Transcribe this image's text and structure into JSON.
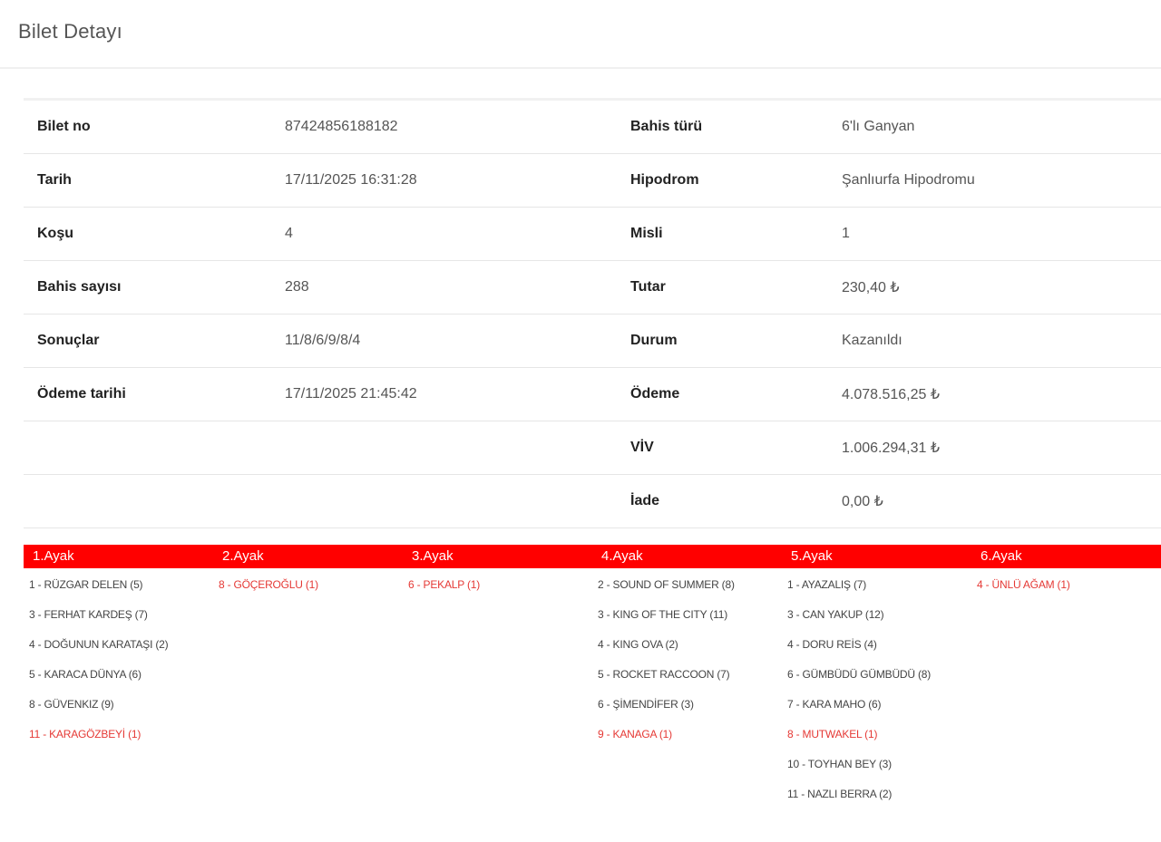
{
  "page": {
    "title": "Bilet Detayı"
  },
  "details": {
    "rows": [
      {
        "label1": "Bilet no",
        "value1": "87424856188182",
        "label2": "Bahis türü",
        "value2": "6'lı Ganyan"
      },
      {
        "label1": "Tarih",
        "value1": "17/11/2025 16:31:28",
        "label2": "Hipodrom",
        "value2": "Şanlıurfa Hipodromu"
      },
      {
        "label1": "Koşu",
        "value1": "4",
        "label2": "Misli",
        "value2": "1"
      },
      {
        "label1": "Bahis sayısı",
        "value1": "288",
        "label2": "Tutar",
        "value2": "230,40 ₺"
      },
      {
        "label1": "Sonuçlar",
        "value1": "11/8/6/9/8/4",
        "label2": "Durum",
        "value2": "Kazanıldı"
      },
      {
        "label1": "Ödeme tarihi",
        "value1": "17/11/2025 21:45:42",
        "label2": "Ödeme",
        "value2": "4.078.516,25 ₺"
      },
      {
        "label1": "",
        "value1": "",
        "label2": "VİV",
        "value2": "1.006.294,31 ₺"
      },
      {
        "label1": "",
        "value1": "",
        "label2": "İade",
        "value2": "0,00 ₺"
      }
    ]
  },
  "legs": {
    "header_color": "#ff0000",
    "winner_color": "#e53935",
    "items": [
      {
        "title": "1.Ayak",
        "entries": [
          {
            "text": "1 - RÜZGAR DELEN (5)",
            "winner": false
          },
          {
            "text": "3 - FERHAT KARDEŞ (7)",
            "winner": false
          },
          {
            "text": "4 - DOĞUNUN KARATAŞI (2)",
            "winner": false
          },
          {
            "text": "5 - KARACA DÜNYA (6)",
            "winner": false
          },
          {
            "text": "8 - GÜVENKIZ (9)",
            "winner": false
          },
          {
            "text": "11 - KARAGÖZBEYİ (1)",
            "winner": true
          }
        ]
      },
      {
        "title": "2.Ayak",
        "entries": [
          {
            "text": "8 - GÖÇEROĞLU (1)",
            "winner": true
          }
        ]
      },
      {
        "title": "3.Ayak",
        "entries": [
          {
            "text": "6 - PEKALP (1)",
            "winner": true
          }
        ]
      },
      {
        "title": "4.Ayak",
        "entries": [
          {
            "text": "2 - SOUND OF SUMMER (8)",
            "winner": false
          },
          {
            "text": "3 - KING OF THE CITY (11)",
            "winner": false
          },
          {
            "text": "4 - KING OVA (2)",
            "winner": false
          },
          {
            "text": "5 - ROCKET RACCOON (7)",
            "winner": false
          },
          {
            "text": "6 - ŞİMENDİFER (3)",
            "winner": false
          },
          {
            "text": "9 - KANAGA (1)",
            "winner": true
          }
        ]
      },
      {
        "title": "5.Ayak",
        "entries": [
          {
            "text": "1 - AYAZALIŞ (7)",
            "winner": false
          },
          {
            "text": "3 - CAN YAKUP (12)",
            "winner": false
          },
          {
            "text": "4 - DORU REİS (4)",
            "winner": false
          },
          {
            "text": "6 - GÜMBÜDÜ GÜMBÜDÜ (8)",
            "winner": false
          },
          {
            "text": "7 - KARA MAHO (6)",
            "winner": false
          },
          {
            "text": "8 - MUTWAKEL (1)",
            "winner": true
          },
          {
            "text": "10 - TOYHAN BEY (3)",
            "winner": false
          },
          {
            "text": "11 - NAZLI BERRA (2)",
            "winner": false
          }
        ]
      },
      {
        "title": "6.Ayak",
        "entries": [
          {
            "text": "4 - ÜNLÜ AĞAM (1)",
            "winner": true
          }
        ]
      }
    ]
  }
}
